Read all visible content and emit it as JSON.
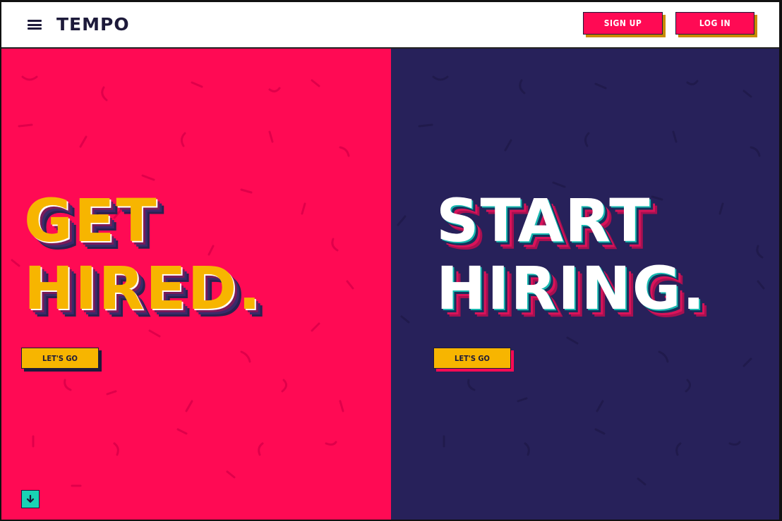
{
  "header": {
    "brand": "TEMPO",
    "menu_icon": "hamburger-menu-icon",
    "signup_label": "SIGN UP",
    "login_label": "LOG IN"
  },
  "left_panel": {
    "headline_line1": "GET",
    "headline_line2": "HIRED.",
    "cta_label": "LET'S GO",
    "background_color": "#ff0a54",
    "headline_color": "#f7b500"
  },
  "right_panel": {
    "headline_line1": "START",
    "headline_line2": "HIRING.",
    "cta_label": "LET'S GO",
    "background_color": "#27215a",
    "headline_color": "#ffffff"
  },
  "scroll_button": {
    "icon": "arrow-down-icon",
    "color": "#19d3b5"
  },
  "colors": {
    "accent_pink": "#ff0a54",
    "accent_navy": "#27215a",
    "accent_yellow": "#f7b500",
    "accent_teal": "#19d3b5"
  }
}
